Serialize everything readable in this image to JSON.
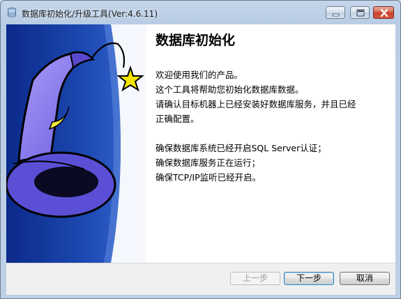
{
  "window": {
    "title": "数据库初始化/升级工具(Ver:4.6.11)"
  },
  "content": {
    "heading": "数据库初始化",
    "paragraph1": [
      "欢迎使用我们的产品。",
      "这个工具将帮助您初始化数据库数据。",
      "请确认目标机器上已经安装好数据库服务，并且已经",
      "正确配置。"
    ],
    "paragraph2": [
      "确保数据库系统已经开启SQL Server认证；",
      "确保数据库服务正在运行；",
      "确保TCP/IP监听已经开启。"
    ]
  },
  "buttons": {
    "prev": "上一步",
    "next": "下一步",
    "cancel": "取消"
  },
  "colors": {
    "side_panel_dark": "#0b2a8a",
    "side_panel_light": "#3f6ed6",
    "hat": "#8d7ef0",
    "star": "#f5e600",
    "moon": "#f1ea3c"
  },
  "icons": {
    "app": "database-icon",
    "side_art": "wizard-hat-image"
  }
}
